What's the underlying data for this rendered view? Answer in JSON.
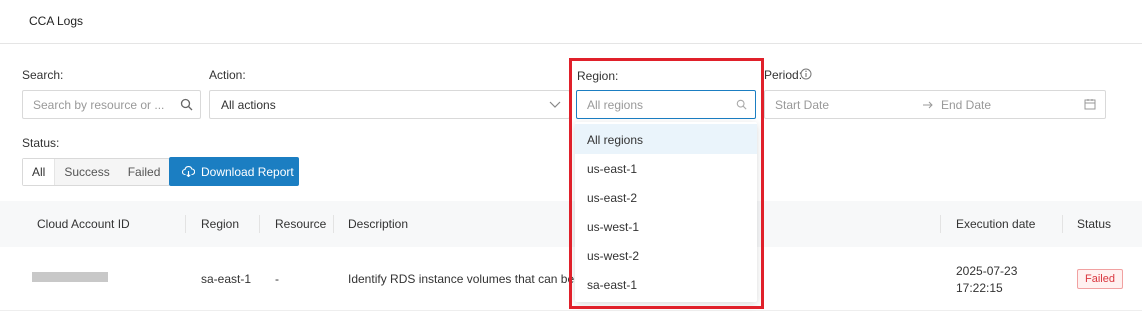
{
  "header": {
    "title": "CCA Logs"
  },
  "filters": {
    "search": {
      "label": "Search:",
      "placeholder": "Search by resource or ..."
    },
    "action": {
      "label": "Action:",
      "value": "All actions"
    },
    "region": {
      "label": "Region:",
      "placeholder": "All regions"
    },
    "period": {
      "label": "Period:",
      "start_placeholder": "Start Date",
      "end_placeholder": "End Date"
    },
    "status": {
      "label": "Status:",
      "options": [
        "All",
        "Success",
        "Failed"
      ],
      "selected": "All"
    }
  },
  "download_button": {
    "label": "Download Report"
  },
  "region_dropdown": {
    "options": [
      "All regions",
      "us-east-1",
      "us-east-2",
      "us-west-1",
      "us-west-2",
      "sa-east-1"
    ],
    "highlighted": "All regions"
  },
  "table": {
    "columns": [
      "Cloud Account ID",
      "Region",
      "Resource",
      "Description",
      "Execution date",
      "Status"
    ],
    "rows": [
      {
        "cloud_account_id": "",
        "region": "sa-east-1",
        "resource": "-",
        "description": "Identify RDS instance volumes that can be migra",
        "execution_date": "2025-07-23",
        "execution_time": "17:22:15",
        "status": "Failed"
      }
    ]
  },
  "colors": {
    "primary": "#1b7ec2",
    "danger": "#d9363e",
    "highlight_border": "#e0202a"
  }
}
